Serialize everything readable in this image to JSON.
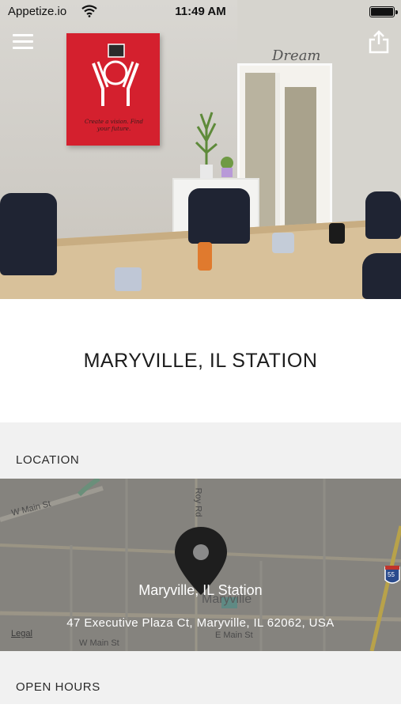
{
  "status_bar": {
    "carrier": "Appetize.io",
    "time": "11:49 AM"
  },
  "nav": {
    "menu_icon": "hamburger-menu-icon",
    "share_icon": "share-icon"
  },
  "hero": {
    "sign_text": "Create a vision. Find your future.",
    "door_text": "Dream"
  },
  "title": "MARYVILLE, IL STATION",
  "sections": {
    "location": "LOCATION",
    "open_hours": "OPEN HOURS"
  },
  "map": {
    "place_name": "Maryville, IL Station",
    "address": "47 Executive Plaza Ct, Maryville, IL 62062, USA",
    "legal": "Legal",
    "city_label": "Maryville",
    "streets": {
      "w_main_1": "W Main St",
      "w_main_2": "W Main St",
      "e_main": "E Main St",
      "roy_rd": "Roy Rd",
      "highway": "55"
    }
  },
  "colors": {
    "section_bg": "#f1f1f1",
    "sign_red": "#d4202e",
    "map_overlay": "#7f7e7a",
    "highway_blue": "#2a4b8d"
  }
}
